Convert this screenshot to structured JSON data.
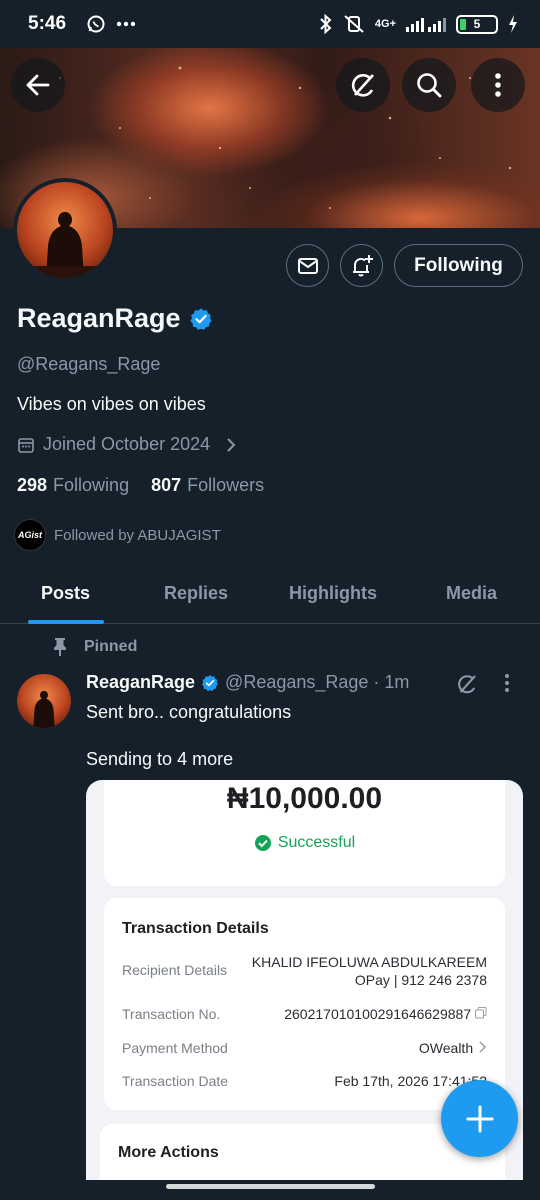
{
  "status": {
    "time": "5:46",
    "network": "4G+",
    "battery": "5",
    "icons": [
      "whatsapp-icon",
      "more-dots-icon",
      "bluetooth-icon",
      "mute-icon",
      "signal-icon",
      "charging-icon"
    ]
  },
  "profile": {
    "name": "ReaganRage",
    "handle": "@Reagans_Rage",
    "bio": "Vibes on vibes on vibes",
    "joined": "Joined October 2024",
    "following_count": "298",
    "following_label": "Following",
    "followers_count": "807",
    "followers_label": "Followers",
    "followed_by": "Followed by ABUJAGIST",
    "followed_by_avatar_text": "AGist",
    "follow_button": "Following"
  },
  "tabs": [
    "Posts",
    "Replies",
    "Highlights",
    "Media"
  ],
  "active_tab": "Posts",
  "post": {
    "pinned_label": "Pinned",
    "author": "ReaganRage",
    "meta": "@Reagans_Rage · 1m",
    "text": "Sent bro.. congratulations",
    "text2": "Sending to 4 more"
  },
  "receipt": {
    "amount": "₦10,000.00",
    "status": "Successful",
    "details_title": "Transaction Details",
    "recipient_label": "Recipient Details",
    "recipient_name": "KHALID IFEOLUWA ABDULKAREEM",
    "recipient_bank": "OPay | 912 246 2378",
    "txn_label": "Transaction No.",
    "txn_value": "260217010100291646629887",
    "method_label": "Payment Method",
    "method_value": "OWealth",
    "date_label": "Transaction Date",
    "date_value": "Feb 17th, 2026 17:41:52",
    "more_actions": "More Actions"
  },
  "colors": {
    "background": "#15202b",
    "accent": "#1d9bf0",
    "muted_text": "#8b98a5",
    "success": "#15a35a"
  }
}
